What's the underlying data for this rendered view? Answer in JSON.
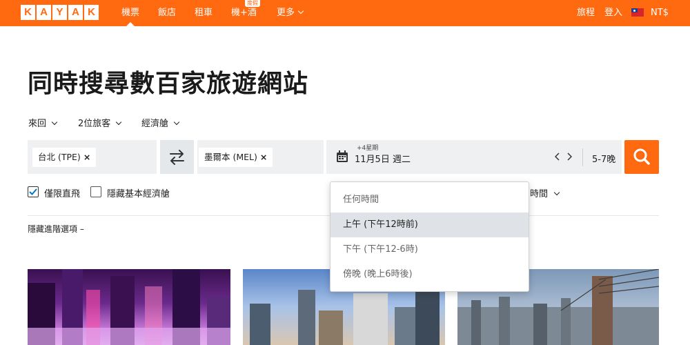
{
  "nav": {
    "logo_letters": [
      "K",
      "A",
      "Y",
      "A",
      "K"
    ],
    "items": [
      "機票",
      "飯店",
      "租車",
      "機+酒",
      "更多"
    ],
    "badge": "度假",
    "right": {
      "trips": "旅程",
      "login": "登入",
      "currency": "NT$"
    },
    "active_index": 0
  },
  "headline": "同時搜尋數百家旅遊網站",
  "options": {
    "trip_type": "來回",
    "travelers": "2位旅客",
    "cabin": "經濟艙"
  },
  "search": {
    "origin": "台北 (TPE)",
    "destination": "墨爾本 (MEL)",
    "flex_label": "+4星期",
    "date": "11月5日 週二",
    "nights": "5-7晚",
    "remove_symbol": "×"
  },
  "filters": {
    "nonstop": {
      "label": "僅限直飛",
      "checked": true
    },
    "hide_basic": {
      "label": "隱藏基本經濟艙",
      "checked": false
    }
  },
  "hide_advanced": "隱藏進階選項 –",
  "partial_right_label": "時間",
  "time_dropdown": {
    "items": [
      "任何時間",
      "上午 (下午12時前)",
      "下午 (下午12-6時)",
      "傍晚 (晚上6時後)"
    ],
    "selected_index": 1
  },
  "colors": {
    "brand": "#ff690f",
    "field_bg": "#eef0f2",
    "selected_bg": "#dfe3e8"
  }
}
